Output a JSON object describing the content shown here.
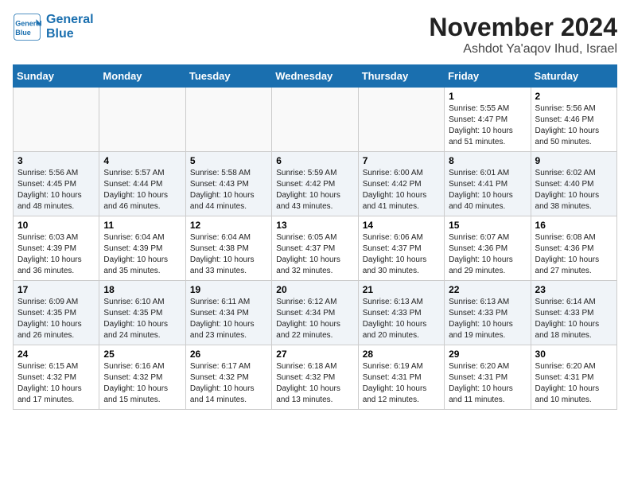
{
  "header": {
    "logo_line1": "General",
    "logo_line2": "Blue",
    "month": "November 2024",
    "location": "Ashdot Ya'aqov Ihud, Israel"
  },
  "weekdays": [
    "Sunday",
    "Monday",
    "Tuesday",
    "Wednesday",
    "Thursday",
    "Friday",
    "Saturday"
  ],
  "weeks": [
    [
      {
        "day": "",
        "info": ""
      },
      {
        "day": "",
        "info": ""
      },
      {
        "day": "",
        "info": ""
      },
      {
        "day": "",
        "info": ""
      },
      {
        "day": "",
        "info": ""
      },
      {
        "day": "1",
        "info": "Sunrise: 5:55 AM\nSunset: 4:47 PM\nDaylight: 10 hours\nand 51 minutes."
      },
      {
        "day": "2",
        "info": "Sunrise: 5:56 AM\nSunset: 4:46 PM\nDaylight: 10 hours\nand 50 minutes."
      }
    ],
    [
      {
        "day": "3",
        "info": "Sunrise: 5:56 AM\nSunset: 4:45 PM\nDaylight: 10 hours\nand 48 minutes."
      },
      {
        "day": "4",
        "info": "Sunrise: 5:57 AM\nSunset: 4:44 PM\nDaylight: 10 hours\nand 46 minutes."
      },
      {
        "day": "5",
        "info": "Sunrise: 5:58 AM\nSunset: 4:43 PM\nDaylight: 10 hours\nand 44 minutes."
      },
      {
        "day": "6",
        "info": "Sunrise: 5:59 AM\nSunset: 4:42 PM\nDaylight: 10 hours\nand 43 minutes."
      },
      {
        "day": "7",
        "info": "Sunrise: 6:00 AM\nSunset: 4:42 PM\nDaylight: 10 hours\nand 41 minutes."
      },
      {
        "day": "8",
        "info": "Sunrise: 6:01 AM\nSunset: 4:41 PM\nDaylight: 10 hours\nand 40 minutes."
      },
      {
        "day": "9",
        "info": "Sunrise: 6:02 AM\nSunset: 4:40 PM\nDaylight: 10 hours\nand 38 minutes."
      }
    ],
    [
      {
        "day": "10",
        "info": "Sunrise: 6:03 AM\nSunset: 4:39 PM\nDaylight: 10 hours\nand 36 minutes."
      },
      {
        "day": "11",
        "info": "Sunrise: 6:04 AM\nSunset: 4:39 PM\nDaylight: 10 hours\nand 35 minutes."
      },
      {
        "day": "12",
        "info": "Sunrise: 6:04 AM\nSunset: 4:38 PM\nDaylight: 10 hours\nand 33 minutes."
      },
      {
        "day": "13",
        "info": "Sunrise: 6:05 AM\nSunset: 4:37 PM\nDaylight: 10 hours\nand 32 minutes."
      },
      {
        "day": "14",
        "info": "Sunrise: 6:06 AM\nSunset: 4:37 PM\nDaylight: 10 hours\nand 30 minutes."
      },
      {
        "day": "15",
        "info": "Sunrise: 6:07 AM\nSunset: 4:36 PM\nDaylight: 10 hours\nand 29 minutes."
      },
      {
        "day": "16",
        "info": "Sunrise: 6:08 AM\nSunset: 4:36 PM\nDaylight: 10 hours\nand 27 minutes."
      }
    ],
    [
      {
        "day": "17",
        "info": "Sunrise: 6:09 AM\nSunset: 4:35 PM\nDaylight: 10 hours\nand 26 minutes."
      },
      {
        "day": "18",
        "info": "Sunrise: 6:10 AM\nSunset: 4:35 PM\nDaylight: 10 hours\nand 24 minutes."
      },
      {
        "day": "19",
        "info": "Sunrise: 6:11 AM\nSunset: 4:34 PM\nDaylight: 10 hours\nand 23 minutes."
      },
      {
        "day": "20",
        "info": "Sunrise: 6:12 AM\nSunset: 4:34 PM\nDaylight: 10 hours\nand 22 minutes."
      },
      {
        "day": "21",
        "info": "Sunrise: 6:13 AM\nSunset: 4:33 PM\nDaylight: 10 hours\nand 20 minutes."
      },
      {
        "day": "22",
        "info": "Sunrise: 6:13 AM\nSunset: 4:33 PM\nDaylight: 10 hours\nand 19 minutes."
      },
      {
        "day": "23",
        "info": "Sunrise: 6:14 AM\nSunset: 4:33 PM\nDaylight: 10 hours\nand 18 minutes."
      }
    ],
    [
      {
        "day": "24",
        "info": "Sunrise: 6:15 AM\nSunset: 4:32 PM\nDaylight: 10 hours\nand 17 minutes."
      },
      {
        "day": "25",
        "info": "Sunrise: 6:16 AM\nSunset: 4:32 PM\nDaylight: 10 hours\nand 15 minutes."
      },
      {
        "day": "26",
        "info": "Sunrise: 6:17 AM\nSunset: 4:32 PM\nDaylight: 10 hours\nand 14 minutes."
      },
      {
        "day": "27",
        "info": "Sunrise: 6:18 AM\nSunset: 4:32 PM\nDaylight: 10 hours\nand 13 minutes."
      },
      {
        "day": "28",
        "info": "Sunrise: 6:19 AM\nSunset: 4:31 PM\nDaylight: 10 hours\nand 12 minutes."
      },
      {
        "day": "29",
        "info": "Sunrise: 6:20 AM\nSunset: 4:31 PM\nDaylight: 10 hours\nand 11 minutes."
      },
      {
        "day": "30",
        "info": "Sunrise: 6:20 AM\nSunset: 4:31 PM\nDaylight: 10 hours\nand 10 minutes."
      }
    ]
  ]
}
